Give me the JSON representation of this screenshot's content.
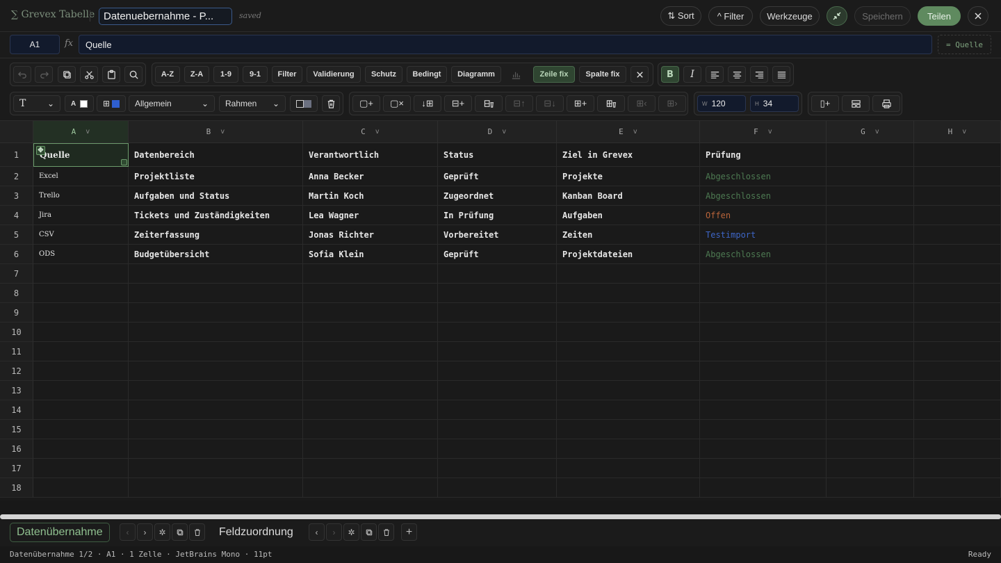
{
  "app": {
    "brand": "∑ Grevex Tabelle",
    "doc_title": "Datenuebernahme - P...",
    "saved": "saved"
  },
  "topbar": {
    "sort": "⇅ Sort",
    "filter": "^ Filter",
    "tools": "Werkzeuge",
    "save": "Speichern",
    "share": "Teilen"
  },
  "formula": {
    "cell_ref": "A1",
    "fx": "fx",
    "value": "Quelle",
    "preview": "= Quelle"
  },
  "toolbar": {
    "sort_az": "A-Z",
    "sort_za": "Z-A",
    "sort_19": "1-9",
    "sort_91": "9-1",
    "filter": "Filter",
    "validation": "Validierung",
    "protect": "Schutz",
    "conditional": "Bedingt",
    "chart": "Diagramm",
    "freeze_row": "Zeile fix",
    "freeze_col": "Spalte fix",
    "bold": "B",
    "italic": "I",
    "text_type": "T",
    "font_color_label": "A",
    "number_format": "Allgemein",
    "border": "Rahmen",
    "width_label": "W",
    "width_value": "120",
    "height_label": "H",
    "height_value": "34"
  },
  "columns": [
    "A",
    "B",
    "C",
    "D",
    "E",
    "F",
    "G",
    "H"
  ],
  "rows": [
    "1",
    "2",
    "3",
    "4",
    "5",
    "6",
    "7",
    "8",
    "9",
    "10",
    "11",
    "12",
    "13",
    "14",
    "15",
    "16",
    "17",
    "18"
  ],
  "table": {
    "header": [
      "Quelle",
      "Datenbereich",
      "Verantwortlich",
      "Status",
      "Ziel in Grevex",
      "Prüfung"
    ],
    "data": [
      [
        "Excel",
        "Projektliste",
        "Anna Becker",
        "Geprüft",
        "Projekte",
        "Abgeschlossen"
      ],
      [
        "Trello",
        "Aufgaben und Status",
        "Martin Koch",
        "Zugeordnet",
        "Kanban Board",
        "Abgeschlossen"
      ],
      [
        "Jira",
        "Tickets und Zuständigkeiten",
        "Lea Wagner",
        "In Prüfung",
        "Aufgaben",
        "Offen"
      ],
      [
        "CSV",
        "Zeiterfassung",
        "Jonas Richter",
        "Vorbereitet",
        "Zeiten",
        "Testimport"
      ],
      [
        "ODS",
        "Budgetübersicht",
        "Sofia Klein",
        "Geprüft",
        "Projektdateien",
        "Abgeschlossen"
      ]
    ]
  },
  "sheets": [
    {
      "name": "Datenübernahme",
      "active": true
    },
    {
      "name": "Feldzuordnung",
      "active": false
    }
  ],
  "statusbar": {
    "left": "Datenübernahme 1/2 · A1 · 1 Zelle · JetBrains Mono · 11pt",
    "right": "Ready"
  },
  "colors": {
    "accent": "#5f8a5f",
    "done": "#4d7a52",
    "open": "#b8643a",
    "test": "#3e66c7",
    "swatch_blue": "#2f5fd0"
  }
}
